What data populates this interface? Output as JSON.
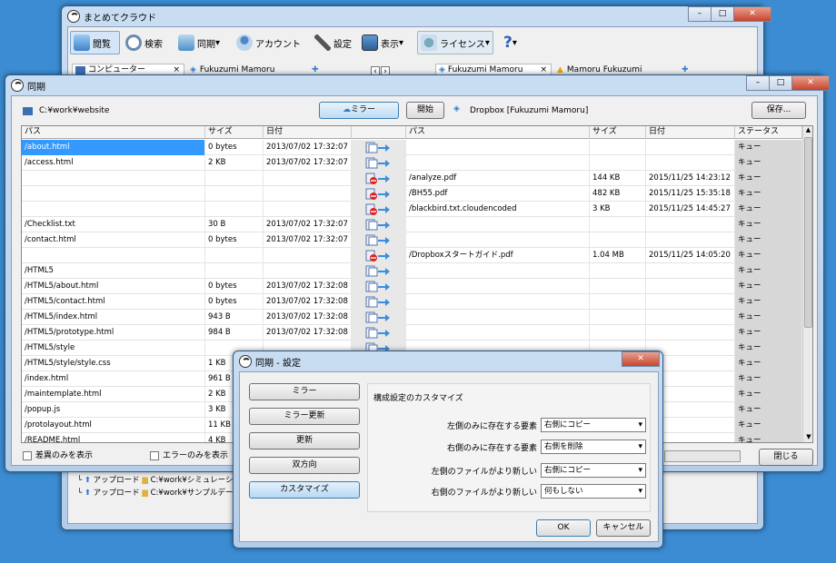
{
  "main_window": {
    "title": "まとめてクラウド",
    "toolbar": {
      "browse": "閲覧",
      "search": "検索",
      "sync": "同期",
      "account": "アカウント",
      "settings": "設定",
      "view": "表示",
      "license": "ライセンス",
      "help": "?"
    },
    "tabs": {
      "left1": "コンピューター",
      "left2": "Fukuzumi Mamoru",
      "right1": "Fukuzumi Mamoru",
      "right2": "Mamoru Fukuzumi"
    },
    "bottom_rows": [
      {
        "action": "アップロード",
        "path": "C:¥work¥シミュレーション"
      },
      {
        "action": "アップロード",
        "path": "C:¥work¥サンプルデー"
      }
    ]
  },
  "sync_window": {
    "title": "同期",
    "left_path": "C:¥work¥website",
    "mirror_button": "ミラー",
    "start_button": "開始",
    "right_path": "Dropbox [Fukuzumi Mamoru]",
    "save_button": "保存...",
    "left_headers": {
      "path": "パス",
      "size": "サイズ",
      "date": "日付"
    },
    "right_headers": {
      "path": "パス",
      "size": "サイズ",
      "date": "日付",
      "status": "ステータス"
    },
    "rows": [
      {
        "lp": "/about.html",
        "ls": "0 bytes",
        "ld": "2013/07/02 17:32:07",
        "rp": "",
        "rs": "",
        "rd": "",
        "st": "キュー",
        "icon": "copy"
      },
      {
        "lp": "/access.html",
        "ls": "2 KB",
        "ld": "2013/07/02 17:32:07",
        "rp": "",
        "rs": "",
        "rd": "",
        "st": "キュー",
        "icon": "copy"
      },
      {
        "lp": "",
        "ls": "",
        "ld": "",
        "rp": "/analyze.pdf",
        "rs": "144 KB",
        "rd": "2015/11/25 14:23:12",
        "st": "キュー",
        "icon": "delete"
      },
      {
        "lp": "",
        "ls": "",
        "ld": "",
        "rp": "/BH55.pdf",
        "rs": "482 KB",
        "rd": "2015/11/25 15:35:18",
        "st": "キュー",
        "icon": "delete"
      },
      {
        "lp": "",
        "ls": "",
        "ld": "",
        "rp": "/blackbird.txt.cloudencoded",
        "rs": "3 KB",
        "rd": "2015/11/25 14:45:27",
        "st": "キュー",
        "icon": "delete"
      },
      {
        "lp": "/Checklist.txt",
        "ls": "30 B",
        "ld": "2013/07/02 17:32:07",
        "rp": "",
        "rs": "",
        "rd": "",
        "st": "キュー",
        "icon": "copy"
      },
      {
        "lp": "/contact.html",
        "ls": "0 bytes",
        "ld": "2013/07/02 17:32:07",
        "rp": "",
        "rs": "",
        "rd": "",
        "st": "キュー",
        "icon": "copy"
      },
      {
        "lp": "",
        "ls": "",
        "ld": "",
        "rp": "/Dropboxスタートガイド.pdf",
        "rs": "1.04 MB",
        "rd": "2015/11/25 14:05:20",
        "st": "キュー",
        "icon": "delete"
      },
      {
        "lp": "/HTML5",
        "ls": "",
        "ld": "",
        "rp": "",
        "rs": "",
        "rd": "",
        "st": "キュー",
        "icon": "copy"
      },
      {
        "lp": "/HTML5/about.html",
        "ls": "0 bytes",
        "ld": "2013/07/02 17:32:08",
        "rp": "",
        "rs": "",
        "rd": "",
        "st": "キュー",
        "icon": "copy"
      },
      {
        "lp": "/HTML5/contact.html",
        "ls": "0 bytes",
        "ld": "2013/07/02 17:32:08",
        "rp": "",
        "rs": "",
        "rd": "",
        "st": "キュー",
        "icon": "copy"
      },
      {
        "lp": "/HTML5/index.html",
        "ls": "943 B",
        "ld": "2013/07/02 17:32:08",
        "rp": "",
        "rs": "",
        "rd": "",
        "st": "キュー",
        "icon": "copy"
      },
      {
        "lp": "/HTML5/prototype.html",
        "ls": "984 B",
        "ld": "2013/07/02 17:32:08",
        "rp": "",
        "rs": "",
        "rd": "",
        "st": "キュー",
        "icon": "copy"
      },
      {
        "lp": "/HTML5/style",
        "ls": "",
        "ld": "",
        "rp": "",
        "rs": "",
        "rd": "",
        "st": "キュー",
        "icon": "copy"
      },
      {
        "lp": "/HTML5/style/style.css",
        "ls": "1 KB",
        "ld": "",
        "rp": "",
        "rs": "",
        "rd": "",
        "st": "キュー",
        "icon": "copy"
      },
      {
        "lp": "/index.html",
        "ls": "961 B",
        "ld": "",
        "rp": "",
        "rs": "",
        "rd": "",
        "st": "キュー",
        "icon": "copy"
      },
      {
        "lp": "/maintemplate.html",
        "ls": "2 KB",
        "ld": "",
        "rp": "",
        "rs": "",
        "rd": "",
        "st": "キュー",
        "icon": "copy"
      },
      {
        "lp": "/popup.js",
        "ls": "3 KB",
        "ld": "",
        "rp": "",
        "rs": "",
        "rd": "",
        "st": "キュー",
        "icon": "copy"
      },
      {
        "lp": "/protolayout.html",
        "ls": "11 KB",
        "ld": "",
        "rp": "",
        "rs": "",
        "rd": "",
        "st": "キュー",
        "icon": "copy"
      },
      {
        "lp": "/README.html",
        "ls": "4 KB",
        "ld": "",
        "rp": "",
        "rs": "",
        "rd": "",
        "st": "キュー",
        "icon": "copy"
      }
    ],
    "diff_only": "差異のみを表示",
    "error_only": "エラーのみを表示",
    "close_button": "閉じる"
  },
  "dialog": {
    "title": "同期 - 設定",
    "modes": [
      "ミラー",
      "ミラー更新",
      "更新",
      "双方向",
      "カスタマイズ"
    ],
    "group_title": "構成設定のカスタマイズ",
    "options": [
      {
        "label": "左側のみに存在する要素",
        "value": "右側にコピー"
      },
      {
        "label": "右側のみに存在する要素",
        "value": "右側を削除"
      },
      {
        "label": "左側のファイルがより新しい",
        "value": "右側にコピー"
      },
      {
        "label": "右側のファイルがより新しい",
        "value": "何もしない"
      }
    ],
    "ok": "OK",
    "cancel": "キャンセル"
  }
}
